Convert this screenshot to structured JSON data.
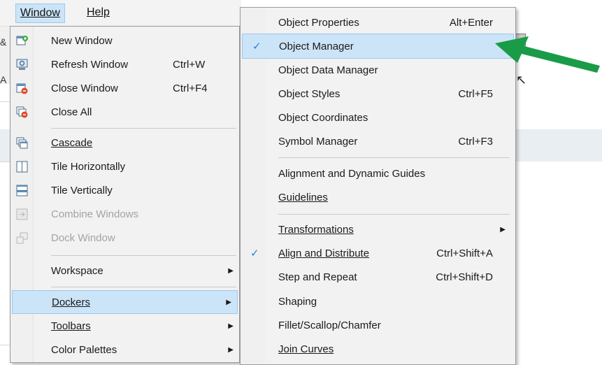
{
  "menubar": {
    "window": "Window",
    "help": "Help"
  },
  "edge_labels": [
    "&",
    "A"
  ],
  "window_menu": {
    "items": [
      {
        "label": "New Window",
        "shortcut": "",
        "icon": "new-window-icon"
      },
      {
        "label": "Refresh Window",
        "shortcut": "Ctrl+W",
        "icon": "refresh-window-icon"
      },
      {
        "label": "Close Window",
        "shortcut": "Ctrl+F4",
        "icon": "close-window-icon"
      },
      {
        "label": "Close All",
        "shortcut": "",
        "icon": "close-all-icon"
      },
      {
        "label": "Cascade",
        "shortcut": "",
        "icon": "cascade-icon"
      },
      {
        "label": "Tile Horizontally",
        "shortcut": "",
        "icon": "tile-horizontally-icon"
      },
      {
        "label": "Tile Vertically",
        "shortcut": "",
        "icon": "tile-vertically-icon"
      },
      {
        "label": "Combine Windows",
        "shortcut": "",
        "icon": "combine-windows-icon"
      },
      {
        "label": "Dock Window",
        "shortcut": "",
        "icon": "dock-window-icon"
      },
      {
        "label": "Workspace",
        "shortcut": ""
      },
      {
        "label": "Dockers",
        "shortcut": ""
      },
      {
        "label": "Toolbars",
        "shortcut": ""
      },
      {
        "label": "Color Palettes",
        "shortcut": ""
      }
    ]
  },
  "dockers_menu": {
    "items": [
      {
        "label": "Object Properties",
        "shortcut": "Alt+Enter",
        "checked": false
      },
      {
        "label": "Object Manager",
        "shortcut": "",
        "checked": true
      },
      {
        "label": "Object Data Manager",
        "shortcut": "",
        "checked": false
      },
      {
        "label": "Object Styles",
        "shortcut": "Ctrl+F5",
        "checked": false
      },
      {
        "label": "Object Coordinates",
        "shortcut": "",
        "checked": false
      },
      {
        "label": "Symbol Manager",
        "shortcut": "Ctrl+F3",
        "checked": false
      },
      {
        "label": "Alignment and Dynamic Guides",
        "shortcut": "",
        "checked": false
      },
      {
        "label": "Guidelines",
        "shortcut": "",
        "checked": false
      },
      {
        "label": "Transformations",
        "shortcut": "",
        "checked": false
      },
      {
        "label": "Align and Distribute",
        "shortcut": "Ctrl+Shift+A",
        "checked": true
      },
      {
        "label": "Step and Repeat",
        "shortcut": "Ctrl+Shift+D",
        "checked": false
      },
      {
        "label": "Shaping",
        "shortcut": "",
        "checked": false
      },
      {
        "label": "Fillet/Scallop/Chamfer",
        "shortcut": "",
        "checked": false
      },
      {
        "label": "Join Curves",
        "shortcut": "",
        "checked": false
      }
    ]
  },
  "colors": {
    "highlight": "#cce4f7",
    "highlight_border": "#99c9ef",
    "annotation_arrow": "#1a9b48",
    "check": "#2b7fd9"
  },
  "icons": {
    "submenu_arrow": "▶",
    "check": "✓"
  }
}
